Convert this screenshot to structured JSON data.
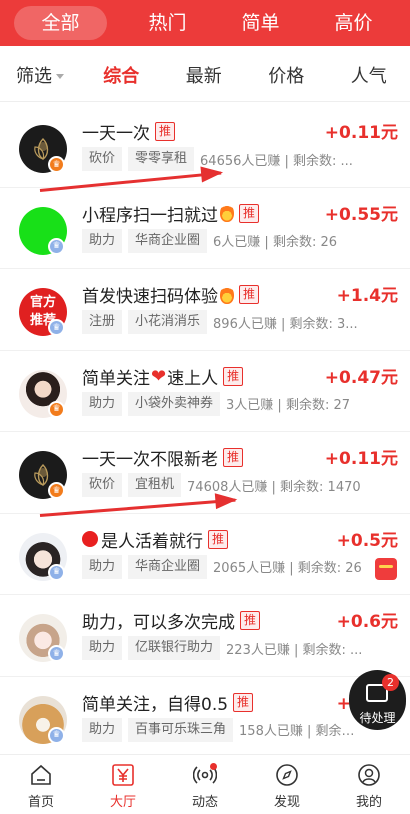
{
  "top_tabs": [
    "全部",
    "热门",
    "简单",
    "高价"
  ],
  "filter": {
    "screen_label": "筛选",
    "sorts": [
      "综合",
      "最新",
      "价格",
      "人气"
    ],
    "active_sort": "综合"
  },
  "tasks": [
    {
      "title": "一天一次",
      "price": "+0.11元",
      "type": "砍价",
      "platform": "零零享租",
      "stats": "64656人已赚 | 剩余数: ...",
      "badge": "推",
      "avatar": "black-flower-avatar",
      "badge_color": "#f27c1c",
      "emoji": ""
    },
    {
      "title": "小程序扫一扫就过",
      "price": "+0.55元",
      "type": "助力",
      "platform": "华商企业圈",
      "stats": "6人已赚 | 剩余数: 26",
      "badge": "推",
      "avatar": "green-circle-avatar",
      "badge_color": "#8fb1e8",
      "emoji": "fire"
    },
    {
      "title": "首发快速扫码体验",
      "price": "+1.4元",
      "type": "注册",
      "platform": "小花消消乐",
      "stats": "896人已赚 | 剩余数: 3...",
      "badge": "推",
      "avatar_text": "官方推荐",
      "avatar": "official-recommend-avatar",
      "badge_color": "#8fb1e8",
      "emoji": "fire"
    },
    {
      "title_a": "简单关注",
      "title_b": "速上人",
      "price": "+0.47元",
      "type": "助力",
      "platform": "小袋外卖神券",
      "stats": "3人已赚 | 剩余数: 27",
      "badge": "推",
      "avatar": "woman-portrait-avatar",
      "badge_color": "#f27c1c",
      "emoji": "heart"
    },
    {
      "title": "一天一次不限新老",
      "price": "+0.11元",
      "type": "砍价",
      "platform": "宜租机",
      "stats": "74608人已赚 | 剩余数: 1470",
      "badge": "推",
      "avatar": "black-flower-avatar",
      "badge_color": "#f27c1c",
      "emoji": ""
    },
    {
      "title": "是人活着就行",
      "price": "+0.5元",
      "type": "助力",
      "platform": "华商企业圈",
      "stats": "2065人已赚 | 剩余数: 26",
      "badge": "推",
      "avatar": "girl-portrait-avatar",
      "badge_color": "#8fb1e8",
      "emoji": "red-dot"
    },
    {
      "title": "助力，可以多次完成",
      "price": "+0.6元",
      "type": "助力",
      "platform": "亿联银行助力",
      "stats": "223人已赚 | 剩余数: ...",
      "badge": "推",
      "avatar": "anime-girl-avatar",
      "badge_color": "#8fb1e8",
      "emoji": ""
    },
    {
      "title": "简单关注，自得0.5",
      "price": "+0.5元",
      "type": "助力",
      "platform": "百事可乐珠三角",
      "stats": "158人已赚 | 剩余数...",
      "badge": "推",
      "avatar": "shiba-dog-avatar",
      "badge_color": "#8fb1e8",
      "emoji": ""
    }
  ],
  "fab": {
    "label": "待处理",
    "count": "2"
  },
  "bottom_nav": [
    {
      "label": "首页",
      "icon": "home-icon"
    },
    {
      "label": "大厅",
      "icon": "yuan-icon",
      "active": true
    },
    {
      "label": "动态",
      "icon": "broadcast-icon"
    },
    {
      "label": "发现",
      "icon": "compass-icon"
    },
    {
      "label": "我的",
      "icon": "profile-icon"
    }
  ],
  "colors": {
    "brand": "#ec3b3a",
    "price": "#e8302c"
  }
}
